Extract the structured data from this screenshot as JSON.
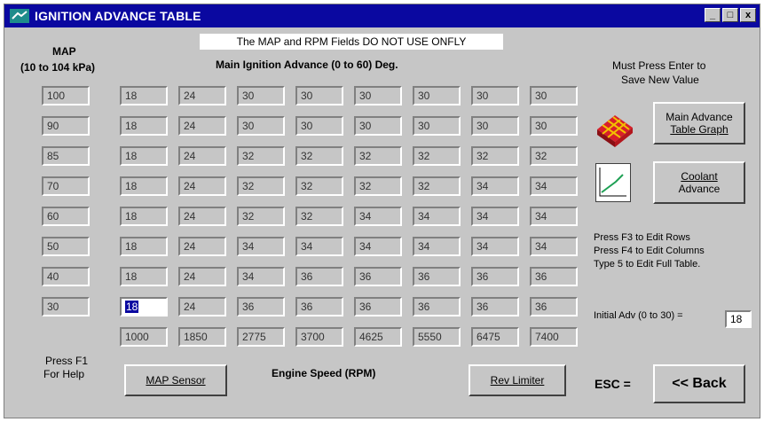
{
  "window": {
    "title": "IGNITION ADVANCE TABLE",
    "min_glyph": "_",
    "max_glyph": "□",
    "close_glyph": "x"
  },
  "notice": "The MAP and RPM Fields DO NOT USE ONFLY",
  "map_header": {
    "line1": "MAP",
    "line2": "(10 to 104 kPa)"
  },
  "table_header": "Main Ignition Advance (0 to 60) Deg.",
  "map_values": [
    "100",
    "90",
    "85",
    "70",
    "60",
    "50",
    "40",
    "30"
  ],
  "advance_rows": [
    [
      "18",
      "24",
      "30",
      "30",
      "30",
      "30",
      "30",
      "30"
    ],
    [
      "18",
      "24",
      "30",
      "30",
      "30",
      "30",
      "30",
      "30"
    ],
    [
      "18",
      "24",
      "32",
      "32",
      "32",
      "32",
      "32",
      "32"
    ],
    [
      "18",
      "24",
      "32",
      "32",
      "32",
      "32",
      "34",
      "34"
    ],
    [
      "18",
      "24",
      "32",
      "32",
      "34",
      "34",
      "34",
      "34"
    ],
    [
      "18",
      "24",
      "34",
      "34",
      "34",
      "34",
      "34",
      "34"
    ],
    [
      "18",
      "24",
      "34",
      "36",
      "36",
      "36",
      "36",
      "36"
    ],
    [
      "18",
      "24",
      "36",
      "36",
      "36",
      "36",
      "36",
      "36"
    ]
  ],
  "rpm_values": [
    "1000",
    "1850",
    "2775",
    "3700",
    "4625",
    "5550",
    "6475",
    "7400"
  ],
  "engine_speed_label": "Engine Speed (RPM)",
  "help": {
    "line1": "Press F1",
    "line2": "For Help"
  },
  "buttons": {
    "map_sensor": "MAP Sensor",
    "rev_limiter": "Rev Limiter",
    "main_graph_line1": "Main Advance",
    "main_graph_line2": "Table Graph",
    "coolant_line1": "Coolant",
    "coolant_line2": "Advance",
    "back": "<< Back"
  },
  "enter_note": {
    "line1": "Must Press Enter to",
    "line2": "Save New Value"
  },
  "edit_instructions": {
    "line1": "Press F3 to Edit Rows",
    "line2": "Press F4 to Edit Columns",
    "line3": "Type 5 to Edit Full Table."
  },
  "initial_adv": {
    "label": "Initial Adv (0 to 30) =",
    "value": "18"
  },
  "esc_label": "ESC =",
  "icons": {
    "graph3d": "3d-surface-graph-icon",
    "linegraph": "line-graph-icon",
    "app": "app-icon"
  },
  "colors": {
    "titlebar": "#0a08a0",
    "face": "#c6c6c6",
    "selected": "#0a08a0"
  }
}
